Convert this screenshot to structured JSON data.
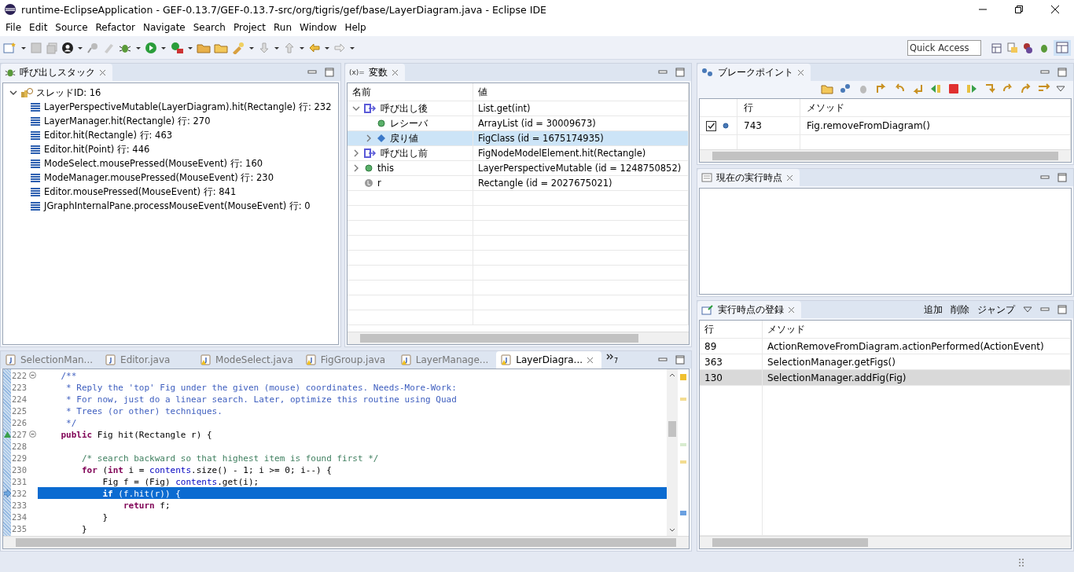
{
  "window": {
    "title": "runtime-EclipseApplication - GEF-0.13.7/GEF-0.13.7-src/org/tigris/gef/base/LayerDiagram.java - Eclipse IDE"
  },
  "menu": [
    "File",
    "Edit",
    "Source",
    "Refactor",
    "Navigate",
    "Search",
    "Project",
    "Run",
    "Window",
    "Help"
  ],
  "quick_access": {
    "placeholder": "Quick Access"
  },
  "call_stack": {
    "title": "呼び出しスタック",
    "thread": {
      "label": "スレッドID: 16",
      "expanded": true,
      "frames": [
        {
          "label": "LayerPerspectiveMutable(LayerDiagram).hit(Rectangle) 行: 232"
        },
        {
          "label": "LayerManager.hit(Rectangle) 行: 270"
        },
        {
          "label": "Editor.hit(Rectangle) 行: 463"
        },
        {
          "label": "Editor.hit(Point) 行: 446"
        },
        {
          "label": "ModeSelect.mousePressed(MouseEvent) 行: 160"
        },
        {
          "label": "ModeManager.mousePressed(MouseEvent) 行: 230"
        },
        {
          "label": "Editor.mousePressed(MouseEvent) 行: 841"
        },
        {
          "label": "JGraphInternalPane.processMouseEvent(MouseEvent) 行: 0"
        }
      ]
    }
  },
  "variables": {
    "title_prefix": "(x)=",
    "title": "変数",
    "columns": [
      "名前",
      "値"
    ],
    "rows": [
      {
        "kind": "method",
        "name": "呼び出し後",
        "value": "List.get(int)",
        "expanded": true,
        "selected": false,
        "children": [
          {
            "kind": "field",
            "name": "レシーバ",
            "value": "ArrayList (id = 30009673)",
            "selected": false
          },
          {
            "kind": "return",
            "name": "戻り値",
            "value": "FigClass (id = 1675174935)",
            "expanded": false,
            "selected": true
          }
        ]
      },
      {
        "kind": "method",
        "name": "呼び出し前",
        "value": "FigNodeModelElement.hit(Rectangle)",
        "expanded": false,
        "selected": false
      },
      {
        "kind": "field",
        "name": "this",
        "value": "LayerPerspectiveMutable (id = 1248750852)",
        "expanded": false,
        "selected": false
      },
      {
        "kind": "local",
        "name": "r",
        "value": "Rectangle (id = 2027675021)",
        "selected": false
      }
    ]
  },
  "breakpoints": {
    "title": "ブレークポイント",
    "columns": [
      "行",
      "メソッド"
    ],
    "rows": [
      {
        "checked": true,
        "line": "743",
        "method": "Fig.removeFromDiagram()"
      }
    ]
  },
  "current_point": {
    "title": "現在の実行時点"
  },
  "registered_points": {
    "title": "実行時点の登録",
    "actions": [
      "追加",
      "削除",
      "ジャンプ"
    ],
    "columns": [
      "行",
      "メソッド"
    ],
    "rows": [
      {
        "line": "89",
        "method": "ActionRemoveFromDiagram.actionPerformed(ActionEvent)",
        "selected": false
      },
      {
        "line": "363",
        "method": "SelectionManager.getFigs()",
        "selected": false
      },
      {
        "line": "130",
        "method": "SelectionManager.addFig(Fig)",
        "selected": true
      }
    ]
  },
  "editor": {
    "tabs": [
      {
        "label": "SelectionMan...",
        "selected": false,
        "warning": false
      },
      {
        "label": "Editor.java",
        "selected": false,
        "warning": false
      },
      {
        "label": "ModeSelect.java",
        "selected": false,
        "warning": true
      },
      {
        "label": "FigGroup.java",
        "selected": false,
        "warning": true
      },
      {
        "label": "LayerManage...",
        "selected": false,
        "warning": true
      },
      {
        "label": "LayerDiagra...",
        "selected": true,
        "warning": true
      }
    ],
    "overflow_count": "7",
    "lines": [
      {
        "number": "222",
        "folding": true,
        "override": false,
        "current": false,
        "segments": [
          {
            "kind": "javadoc",
            "text": "    /**"
          }
        ]
      },
      {
        "number": "223",
        "folding": false,
        "override": false,
        "current": false,
        "segments": [
          {
            "kind": "javadoc",
            "text": "     * Reply the 'top' Fig under the given (mouse) coordinates. Needs-More-Work:"
          }
        ]
      },
      {
        "number": "224",
        "folding": false,
        "override": false,
        "current": false,
        "segments": [
          {
            "kind": "javadoc",
            "text": "     * For now, just do a linear search. Later, optimize this routine using Quad"
          }
        ]
      },
      {
        "number": "225",
        "folding": false,
        "override": false,
        "current": false,
        "segments": [
          {
            "kind": "javadoc",
            "text": "     * Trees (or other) techniques."
          }
        ]
      },
      {
        "number": "226",
        "folding": false,
        "override": false,
        "current": false,
        "segments": [
          {
            "kind": "javadoc",
            "text": "     */"
          }
        ]
      },
      {
        "number": "227",
        "folding": true,
        "override": true,
        "current": false,
        "segments": [
          {
            "kind": "keyword",
            "text": "    public"
          },
          {
            "kind": "plain",
            "text": " Fig hit(Rectangle r) {"
          }
        ]
      },
      {
        "number": "228",
        "folding": false,
        "override": false,
        "current": false
      },
      {
        "number": "229",
        "folding": false,
        "override": false,
        "current": false,
        "segments": [
          {
            "kind": "comment",
            "text": "        /* search backward so that highest item is found first */"
          }
        ]
      },
      {
        "number": "230",
        "folding": false,
        "override": false,
        "current": false,
        "segments": [
          {
            "kind": "keyword",
            "text": "        for"
          },
          {
            "kind": "plain",
            "text": " ("
          },
          {
            "kind": "keyword",
            "text": "int"
          },
          {
            "kind": "plain",
            "text": " i = "
          },
          {
            "kind": "field",
            "text": "contents"
          },
          {
            "kind": "plain",
            "text": ".size() - 1; i >= 0; i--) {"
          }
        ]
      },
      {
        "number": "231",
        "folding": false,
        "override": false,
        "current": false,
        "segments": [
          {
            "kind": "plain",
            "text": "            Fig f = (Fig) "
          },
          {
            "kind": "field",
            "text": "contents"
          },
          {
            "kind": "plain",
            "text": ".get(i);"
          }
        ]
      },
      {
        "number": "232",
        "folding": false,
        "override": false,
        "current": true,
        "segments": [
          {
            "kind": "keyword",
            "text": "            if"
          },
          {
            "kind": "plain",
            "text": " (f.hit(r)) {"
          }
        ]
      },
      {
        "number": "233",
        "folding": false,
        "override": false,
        "current": false,
        "segments": [
          {
            "kind": "keyword",
            "text": "                return"
          },
          {
            "kind": "plain",
            "text": " f;"
          }
        ]
      },
      {
        "number": "234",
        "folding": false,
        "override": false,
        "current": false,
        "segments": [
          {
            "kind": "plain",
            "text": "            }"
          }
        ]
      },
      {
        "number": "235",
        "folding": false,
        "override": false,
        "current": false,
        "segments": [
          {
            "kind": "plain",
            "text": "        }"
          }
        ]
      }
    ]
  }
}
